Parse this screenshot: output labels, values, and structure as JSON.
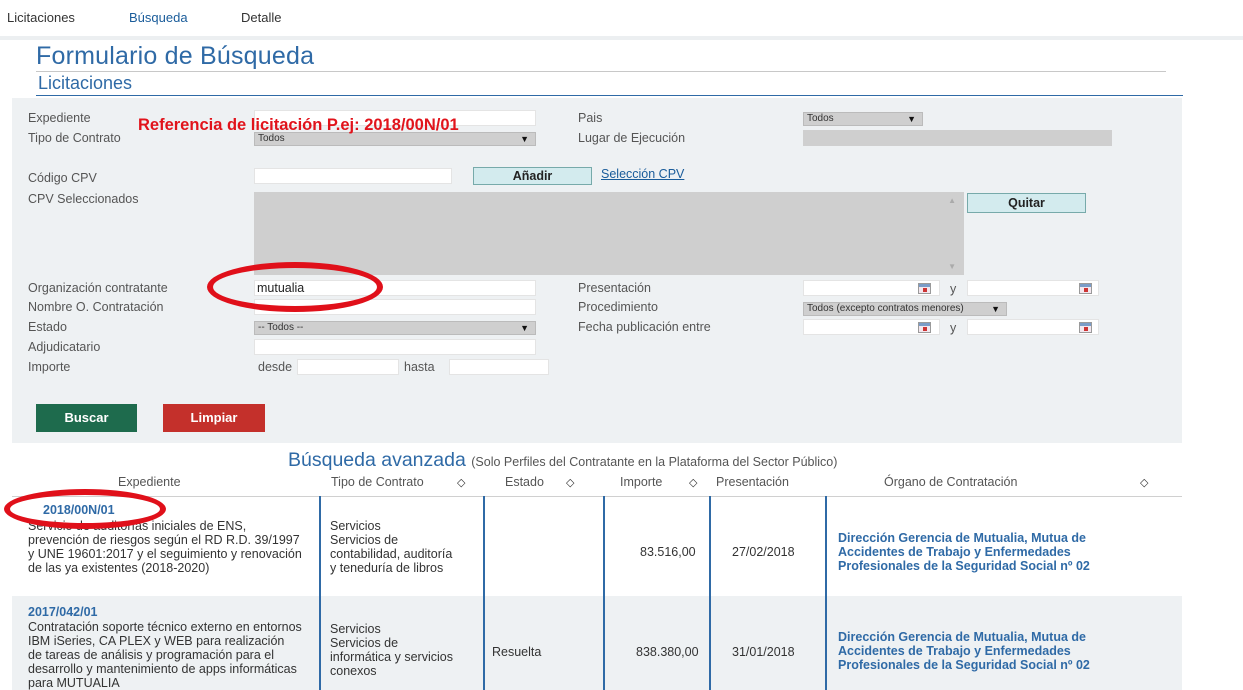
{
  "nav": {
    "items": [
      {
        "label": "Licitaciones"
      },
      {
        "label": "Búsqueda"
      },
      {
        "label": "Detalle"
      }
    ]
  },
  "page": {
    "title": "Formulario de Búsqueda",
    "subtitle": "Licitaciones"
  },
  "form": {
    "expediente_label": "Expediente",
    "reference_hint": "Referencia de licitación P.ej: 2018/00N/01",
    "tipo_contrato_label": "Tipo de Contrato",
    "tipo_contrato_value": "Todos",
    "pais_label": "Pais",
    "pais_value": "Todos",
    "lugar_label": "Lugar de Ejecución",
    "cpv_label": "Código CPV",
    "add_label": "Añadir",
    "seleccion_cpv": "Selección CPV",
    "cpv_selected_label": "CPV Seleccionados",
    "quitar_label": "Quitar",
    "organizacion_label": "Organización contratante",
    "organizacion_value": "mutualia",
    "nombre_label": "Nombre O. Contratación",
    "estado_label": "Estado",
    "estado_value": "-- Todos --",
    "adjudicatario_label": "Adjudicatario",
    "importe_label": "Importe",
    "desde_label": "desde",
    "hasta_label": "hasta",
    "presentacion_label": "Presentación",
    "y_label": "y",
    "procedimiento_label": "Procedimiento",
    "procedimiento_value": "Todos (excepto contratos menores)",
    "fecha_pub_label": "Fecha publicación entre",
    "buscar_label": "Buscar",
    "limpiar_label": "Limpiar"
  },
  "advanced": {
    "title": "Búsqueda avanzada",
    "note": "(Solo Perfiles del Contratante en la Plataforma del Sector Público)"
  },
  "table": {
    "headers": {
      "expediente": "Expediente",
      "tipo": "Tipo de Contrato",
      "estado": "Estado",
      "importe": "Importe",
      "presentacion": "Presentación",
      "organo": "Órgano de Contratación"
    },
    "rows": [
      {
        "id": "2018/00N/01",
        "desc1": "Servicio de auditorías iniciales de ENS,",
        "desc2": "prevención de riesgos según el RD R.D. 39/1997",
        "desc3": "y UNE 19601:2017 y el seguimiento y renovación",
        "desc4": "de las ya existentes (2018-2020)",
        "tipo1": "Servicios",
        "tipo2": "Servicios de",
        "tipo3": "contabilidad, auditoría",
        "tipo4": "y teneduría de libros",
        "estado": "",
        "importe": "83.516,00",
        "presentacion": "27/02/2018",
        "org1": "Dirección Gerencia de Mutualia, Mutua de",
        "org2": "Accidentes de Trabajo y Enfermedades",
        "org3": "Profesionales de la Seguridad Social nº 02"
      },
      {
        "id": "2017/042/01",
        "desc1": "Contratación soporte técnico externo en entornos",
        "desc2": "IBM iSeries, CA PLEX y WEB para realización",
        "desc3": "de tareas de análisis y programación para el",
        "desc4": "desarrollo y mantenimiento de apps informáticas",
        "desc5": "para MUTUALIA",
        "tipo1": "Servicios",
        "tipo2": "Servicios de",
        "tipo3": "informática y servicios",
        "tipo4": "conexos",
        "estado": "Resuelta",
        "importe": "838.380,00",
        "presentacion": "31/01/2018",
        "org1": "Dirección Gerencia de Mutualia, Mutua de",
        "org2": "Accidentes de Trabajo y Enfermedades",
        "org3": "Profesionales de la Seguridad Social nº 02"
      }
    ]
  },
  "colors": {
    "brand_blue": "#2f6aa6",
    "annotation_red": "#e1131b",
    "buscar_green": "#1e6b4d",
    "limpiar_red": "#c4302b"
  }
}
